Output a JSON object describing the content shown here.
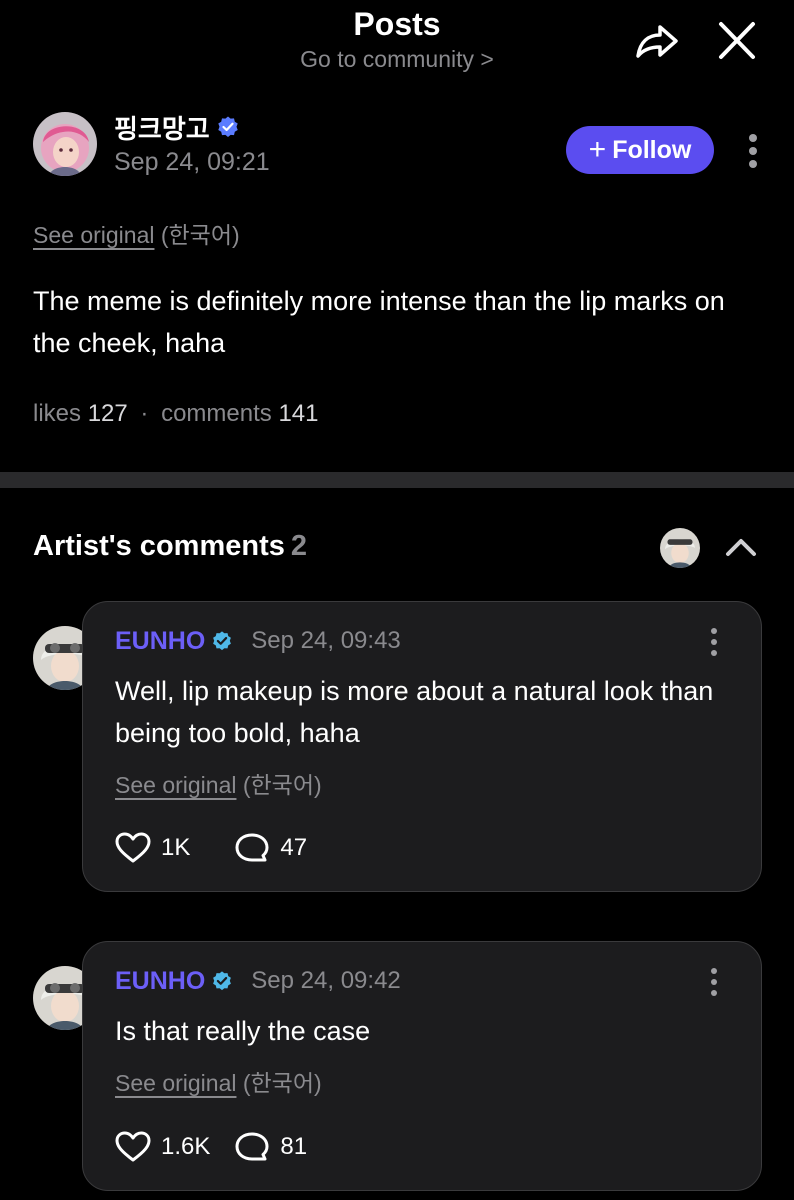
{
  "header": {
    "title": "Posts",
    "subtitle": "Go to community >"
  },
  "post": {
    "author": "핑크망고",
    "time": "Sep 24, 09:21",
    "follow_label": "Follow",
    "see_original": "See original",
    "language": "(한국어)",
    "body": "The meme is definitely more intense than the lip marks on the cheek, haha",
    "likes_label": "likes",
    "likes_count": "127",
    "separator": "·",
    "comments_label": "comments",
    "comments_count": "141"
  },
  "artist_comments": {
    "title": "Artist's comments",
    "count": "2",
    "items": [
      {
        "author": "EUNHO",
        "time": "Sep 24, 09:43",
        "text": "Well, lip makeup is more about a natural look than being too bold, haha",
        "see_original": "See original",
        "language": "(한국어)",
        "likes": "1K",
        "replies": "47"
      },
      {
        "author": "EUNHO",
        "time": "Sep 24, 09:42",
        "text": "Is that really the case",
        "see_original": "See original",
        "language": "(한국어)",
        "likes": "1.6K",
        "replies": "81"
      }
    ]
  },
  "icons": {
    "share": "share-icon",
    "close": "close-icon",
    "verified": "verified-badge-icon",
    "more": "more-vertical-icon",
    "collapse": "chevron-up-icon",
    "like": "heart-icon",
    "reply": "comment-bubble-icon"
  },
  "colors": {
    "background": "#000000",
    "accent": "#5b4df0",
    "artist_name": "#6c5ff7",
    "muted_text": "#8a8a8e",
    "card_bg": "#1c1c1e",
    "verified_user": "#5b7cff",
    "verified_artist": "#4fb8e8"
  }
}
